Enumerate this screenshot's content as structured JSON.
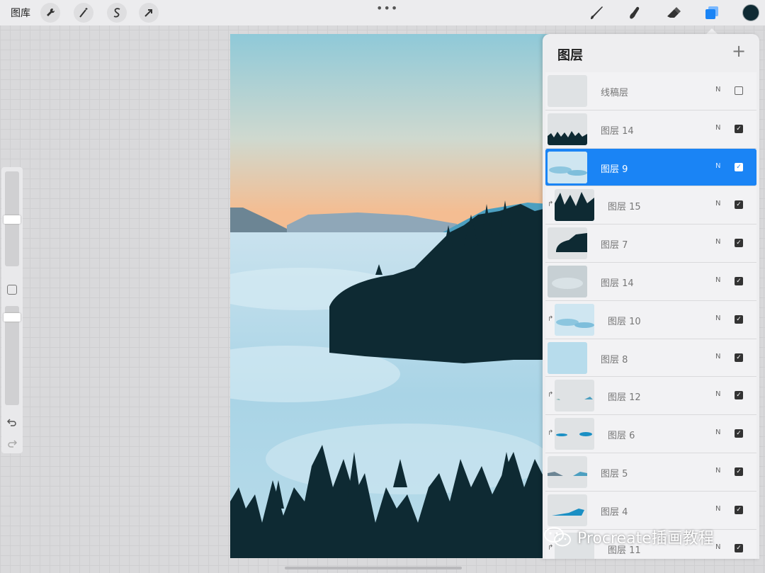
{
  "topbar": {
    "gallery_label": "图库",
    "more_dots": "•••",
    "tools": [
      "wrench-icon",
      "magic-wand-icon",
      "selection-icon",
      "transform-icon"
    ],
    "right_tools": [
      "brush-icon",
      "smudge-icon",
      "eraser-icon",
      "layers-icon"
    ],
    "active_color": "#0f2a33"
  },
  "sidebar": {
    "size_level": 0.18,
    "opacity_level": 0.06
  },
  "layers_panel": {
    "title": "图层",
    "add_symbol": "+",
    "layers": [
      {
        "name": "线稿层",
        "blend": "N",
        "visible": false,
        "selected": false,
        "clipped": false,
        "thumb": "blank"
      },
      {
        "name": "图层 14",
        "blend": "N",
        "visible": true,
        "selected": false,
        "clipped": false,
        "thumb": "trees-bottom"
      },
      {
        "name": "图层 9",
        "blend": "N",
        "visible": true,
        "selected": true,
        "clipped": false,
        "thumb": "clouds-blue"
      },
      {
        "name": "图层 15",
        "blend": "N",
        "visible": true,
        "selected": false,
        "clipped": true,
        "thumb": "trees-dark"
      },
      {
        "name": "图层 7",
        "blend": "N",
        "visible": true,
        "selected": false,
        "clipped": false,
        "thumb": "island"
      },
      {
        "name": "图层 14",
        "blend": "N",
        "visible": true,
        "selected": false,
        "clipped": false,
        "thumb": "fog"
      },
      {
        "name": "图层 10",
        "blend": "N",
        "visible": true,
        "selected": false,
        "clipped": true,
        "thumb": "clouds-blue"
      },
      {
        "name": "图层 8",
        "blend": "N",
        "visible": true,
        "selected": false,
        "clipped": false,
        "thumb": "light-blue"
      },
      {
        "name": "图层 12",
        "blend": "N",
        "visible": true,
        "selected": false,
        "clipped": true,
        "thumb": "small-marks"
      },
      {
        "name": "图层 6",
        "blend": "N",
        "visible": true,
        "selected": false,
        "clipped": true,
        "thumb": "blue-marks"
      },
      {
        "name": "图层 5",
        "blend": "N",
        "visible": true,
        "selected": false,
        "clipped": false,
        "thumb": "hills-grey"
      },
      {
        "name": "图层 4",
        "blend": "N",
        "visible": true,
        "selected": false,
        "clipped": false,
        "thumb": "hill-blue"
      },
      {
        "name": "图层 11",
        "blend": "N",
        "visible": true,
        "selected": false,
        "clipped": true,
        "thumb": "blank"
      }
    ]
  },
  "watermark": {
    "text": "Procreate插画教程"
  },
  "colors": {
    "selection": "#1a84f5",
    "sky_top": "#8fc9d8",
    "sky_bottom": "#f4bd92",
    "fog": "#b9dcea",
    "trees": "#0e2a33"
  }
}
